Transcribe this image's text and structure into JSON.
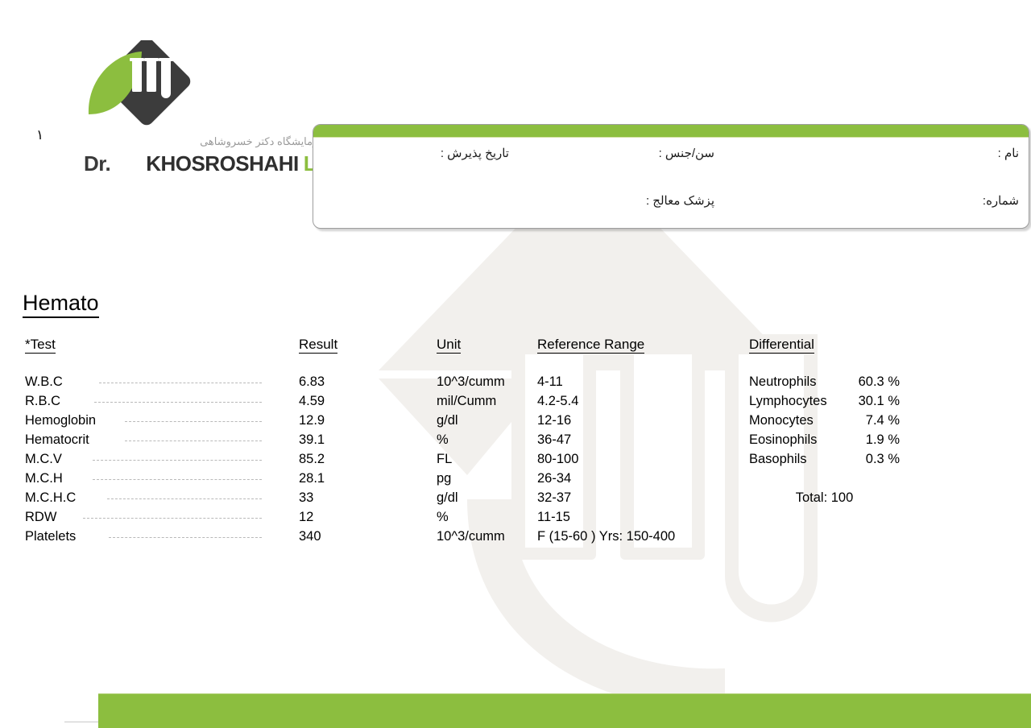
{
  "brand": {
    "logo_icon": "lab-diamond-testtubes-leaf-logo",
    "persian_name": "آزمایشگاه دکتر خسروشاهی",
    "wordmark_prefix": "Dr.",
    "wordmark_name": "KHOSROSHAHI",
    "wordmark_suffix": "LAB",
    "green": "#8cbe3f",
    "dark": "#3a3a3a",
    "gray": "#9a9a9a"
  },
  "page_number": "۱",
  "patient_box": {
    "name_label": "نام :",
    "age_sex_label": "سن/جنس :",
    "admission_date_label": "تاریخ پذیرش :",
    "number_label": "شماره:",
    "physician_label": "پزشک معالج :"
  },
  "section": {
    "title": "Hemato"
  },
  "table": {
    "headers": {
      "test": "*Test",
      "result": "Result",
      "unit": "Unit",
      "reference_range": "Reference Range",
      "differential": "Differential"
    },
    "rows": [
      {
        "test": "W.B.C",
        "result": "6.83",
        "unit": "10^3/cumm",
        "reference": "4-11"
      },
      {
        "test": "R.B.C",
        "result": "4.59",
        "unit": "mil/Cumm",
        "reference": "4.2-5.4"
      },
      {
        "test": "Hemoglobin",
        "result": "12.9",
        "unit": "g/dl",
        "reference": "12-16"
      },
      {
        "test": "Hematocrit",
        "result": "39.1",
        "unit": "%",
        "reference": "36-47"
      },
      {
        "test": "M.C.V",
        "result": "85.2",
        "unit": "FL",
        "reference": "80-100"
      },
      {
        "test": "M.C.H",
        "result": "28.1",
        "unit": "pg",
        "reference": "26-34"
      },
      {
        "test": "M.C.H.C",
        "result": "33",
        "unit": "g/dl",
        "reference": "32-37"
      },
      {
        "test": "RDW",
        "result": "12",
        "unit": "%",
        "reference": "11-15"
      },
      {
        "test": "Platelets",
        "result": "340",
        "unit": "10^3/cumm",
        "reference": "F (15-60 ) Yrs: 150-400"
      }
    ],
    "differential": [
      {
        "name": "Neutrophils",
        "value": "60.3 %"
      },
      {
        "name": "Lymphocytes",
        "value": "30.1 %"
      },
      {
        "name": "Monocytes",
        "value": "7.4 %"
      },
      {
        "name": "Eosinophils",
        "value": "1.9 %"
      },
      {
        "name": "Basophils",
        "value": "0.3 %"
      }
    ],
    "differential_total": "Total: 100"
  }
}
